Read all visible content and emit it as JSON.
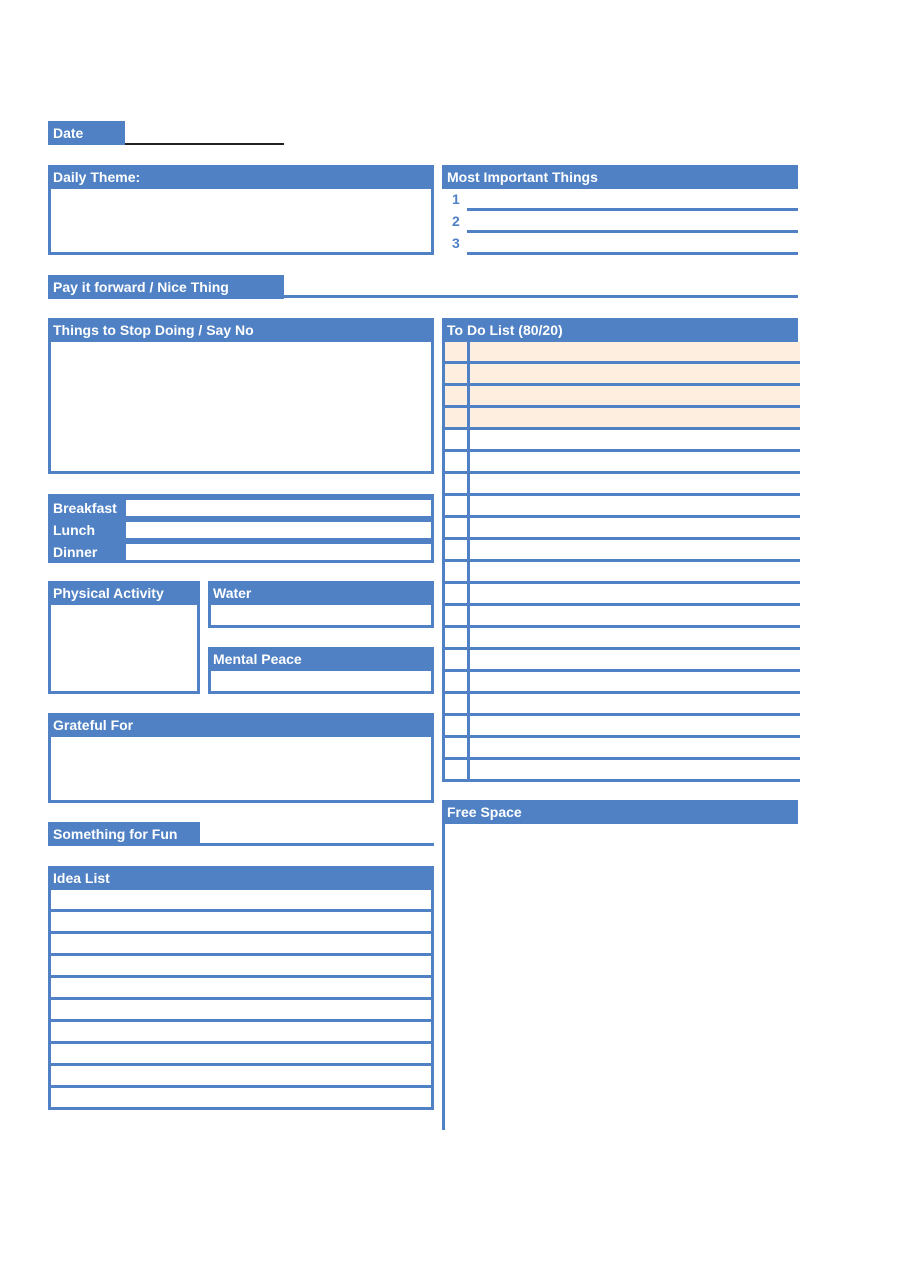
{
  "colors": {
    "accent": "#4f81c4",
    "highlight_row": "#fdeedf",
    "background": "#ffffff"
  },
  "date": {
    "label": "Date",
    "value": ""
  },
  "daily_theme": {
    "label": "Daily Theme:",
    "value": ""
  },
  "most_important": {
    "label": "Most Important Things",
    "items": [
      {
        "num": "1",
        "value": ""
      },
      {
        "num": "2",
        "value": ""
      },
      {
        "num": "3",
        "value": ""
      }
    ]
  },
  "pay_it_forward": {
    "label": "Pay it forward / Nice Thing",
    "value": ""
  },
  "stop_doing": {
    "label": "Things to Stop Doing / Say No",
    "value": ""
  },
  "todo": {
    "label": "To Do List (80/20)",
    "row_count": 20,
    "highlighted_rows": 4
  },
  "meals": [
    {
      "label": "Breakfast",
      "value": ""
    },
    {
      "label": "Lunch",
      "value": ""
    },
    {
      "label": "Dinner",
      "value": ""
    }
  ],
  "physical_activity": {
    "label": "Physical Activity",
    "value": ""
  },
  "water": {
    "label": "Water",
    "value": ""
  },
  "mental_peace": {
    "label": "Mental Peace",
    "value": ""
  },
  "grateful_for": {
    "label": "Grateful For",
    "value": ""
  },
  "something_for_fun": {
    "label": "Something for Fun",
    "value": ""
  },
  "free_space": {
    "label": "Free Space"
  },
  "idea_list": {
    "label": "Idea List",
    "row_count": 10
  }
}
